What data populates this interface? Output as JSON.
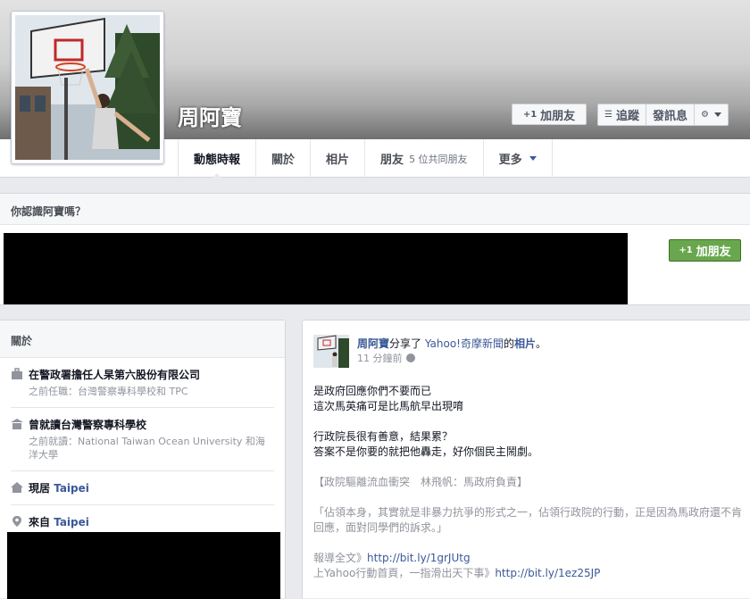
{
  "profile": {
    "name": "周阿寶"
  },
  "actions": {
    "add_friend": "加朋友",
    "follow": "追蹤",
    "message": "發訊息"
  },
  "nav": {
    "tabs": [
      {
        "label": "動態時報"
      },
      {
        "label": "關於"
      },
      {
        "label": "相片"
      },
      {
        "label": "朋友",
        "sub": "5 位共同朋友"
      },
      {
        "label": "更多"
      }
    ]
  },
  "know": {
    "title": "你認識阿寶嗎？",
    "add_label": "加朋友"
  },
  "about": {
    "title": "關於",
    "items": [
      {
        "title": "在警政署擔任人杲第六股份有限公司",
        "sub": "之前任職：台灣警察專科學校和 TPC"
      },
      {
        "title": "曾就讀台灣警察專科學校",
        "sub": "之前就讀：National Taiwan Ocean University 和海洋大學"
      },
      {
        "prefix": "現居 ",
        "link": "Taipei"
      },
      {
        "prefix": "來自 ",
        "link": "Taipei"
      }
    ]
  },
  "post": {
    "author": "周阿寶",
    "action_text": "分享了 ",
    "source": "Yahoo!奇摩新聞",
    "possessive": "的",
    "object": "相片",
    "end": "。",
    "time": "11 分鐘前",
    "lines": [
      "是政府回應你們不要而已",
      "這次馬英痛可是比馬航早出現唷",
      "",
      "行政院長很有善意，結果累？",
      "答案不是你要的就把他轟走，好你個民主鬧劇。",
      ""
    ],
    "quote_lines": [
      "【政院驅離流血衝突　林飛帆：馬政府負責】",
      "",
      "「佔領本身，其實就是非暴力抗爭的形式之一，佔領行政院的行動，正是因為馬政府還不肯回應，面對同學們的訴求。」",
      ""
    ],
    "link1_prefix": "報導全文》",
    "link1": "http://bit.ly/1grJUtg",
    "link2_prefix": "上Yahoo行動首頁，一指滑出天下事》",
    "link2": "http://bit.ly/1ez25JP"
  }
}
